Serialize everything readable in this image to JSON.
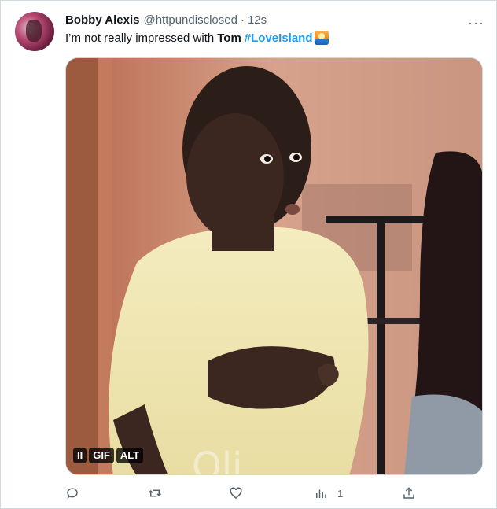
{
  "tweet": {
    "author_name": "Bobby Alexis",
    "author_handle": "@httpundisclosed",
    "separator": "·",
    "timestamp": "12s",
    "text_plain": "I’m not really impressed with",
    "text_bold": "Tom",
    "hashtag": "#LoveIsland",
    "hashtag_emoji_icon": "love-island-emoji-icon",
    "more_label": "···"
  },
  "media": {
    "type": "gif",
    "badges": {
      "pause": "II",
      "gif": "GIF",
      "alt": "ALT"
    }
  },
  "actions": {
    "reply_icon": "reply-icon",
    "retweet_icon": "retweet-icon",
    "like_icon": "like-icon",
    "views_icon": "views-icon",
    "views_count": "1",
    "share_icon": "share-icon"
  },
  "colors": {
    "accent": "#1d9bf0",
    "secondary_text": "#536471",
    "primary_text": "#0f1419",
    "border": "#cfd9de"
  }
}
